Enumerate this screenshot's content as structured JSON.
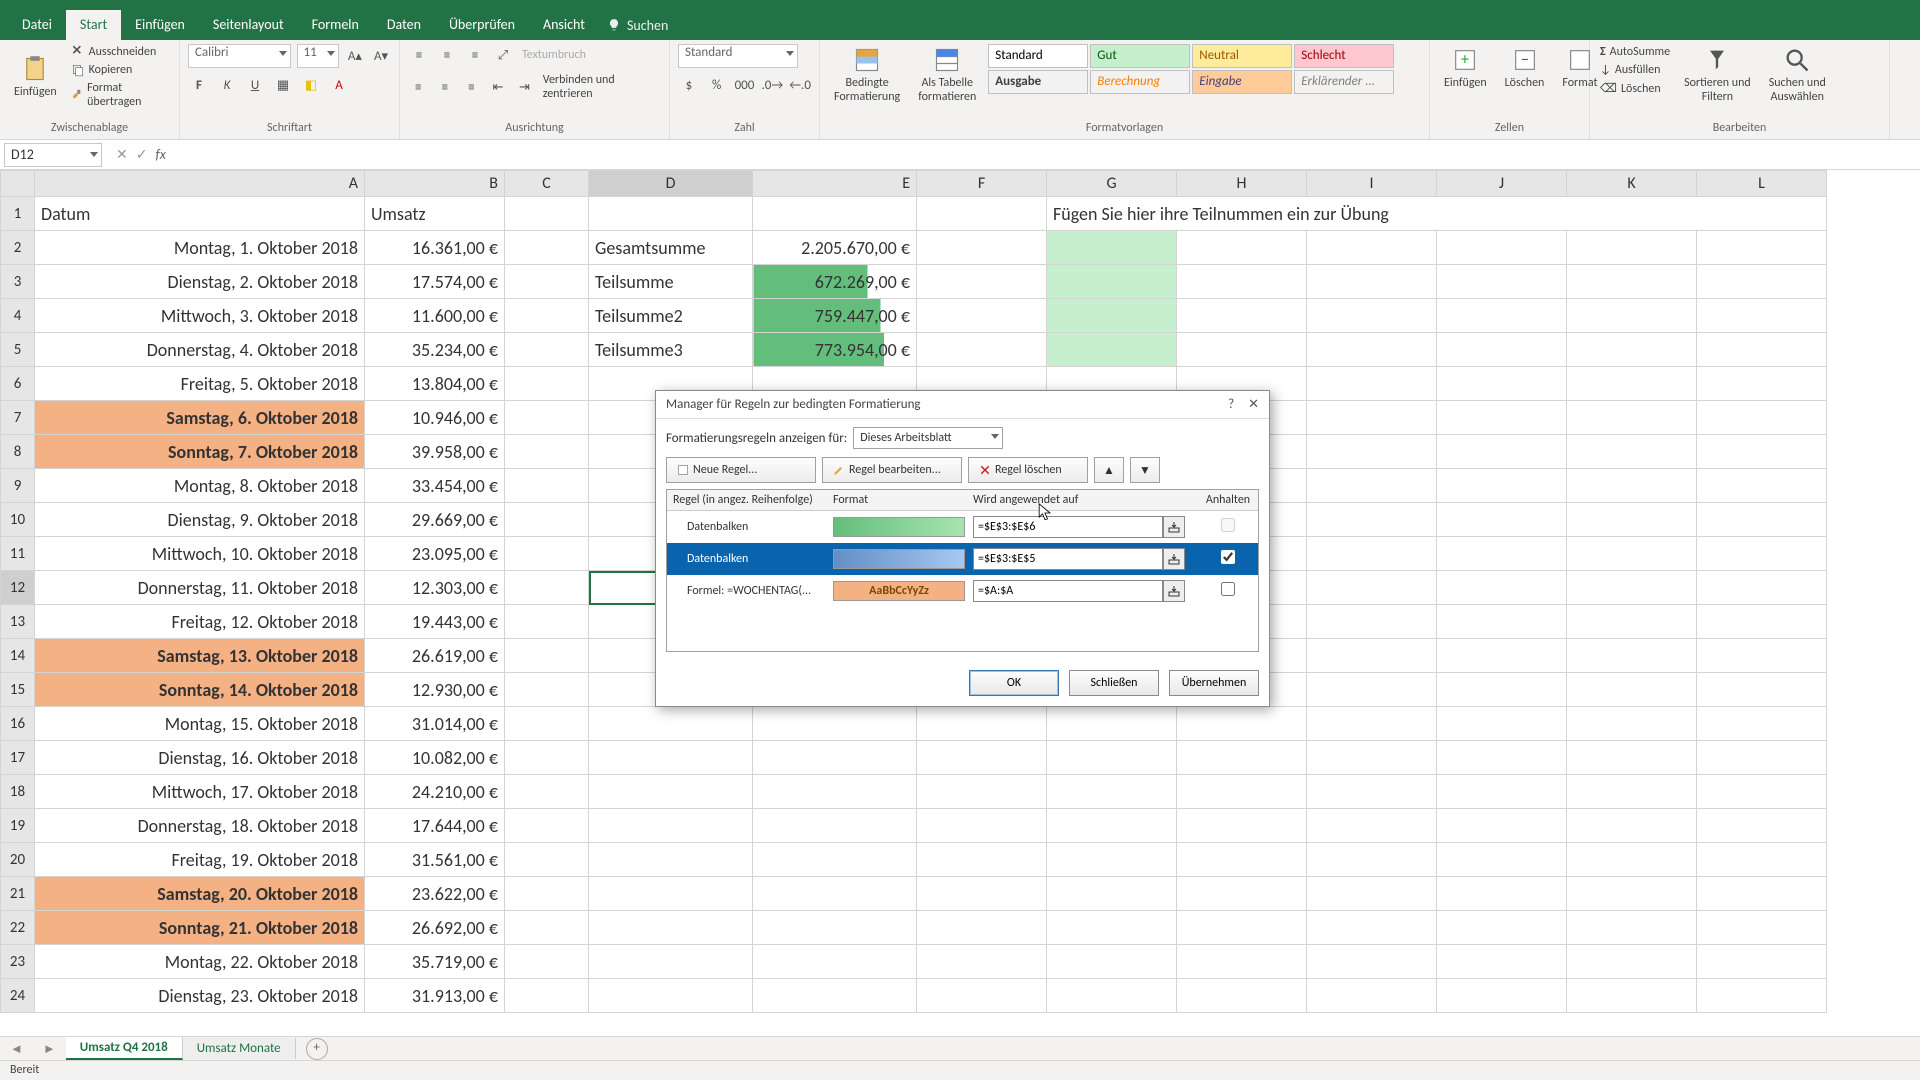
{
  "ribbon_tabs": [
    "Datei",
    "Start",
    "Einfügen",
    "Seitenlayout",
    "Formeln",
    "Daten",
    "Überprüfen",
    "Ansicht"
  ],
  "ribbon_active": "Start",
  "search_placeholder": "Suchen",
  "clipboard": {
    "paste": "Einfügen",
    "cut": "Ausschneiden",
    "copy": "Kopieren",
    "painter": "Format übertragen",
    "label": "Zwischenablage"
  },
  "font": {
    "name": "Calibri",
    "size": "11",
    "label": "Schriftart"
  },
  "alignment": {
    "wrap": "Textumbruch",
    "merge": "Verbinden und zentrieren",
    "label": "Ausrichtung"
  },
  "number": {
    "format": "Standard",
    "label": "Zahl"
  },
  "styles": {
    "cond": "Bedingte\nFormatierung",
    "table": "Als Tabelle\nformatieren",
    "cells": [
      "Standard",
      "Gut",
      "Neutral",
      "Schlecht",
      "Ausgabe",
      "Berechnung",
      "Eingabe",
      "Erklärender ..."
    ],
    "label": "Formatvorlagen"
  },
  "cells": {
    "insert": "Einfügen",
    "delete": "Löschen",
    "format": "Format",
    "label": "Zellen"
  },
  "editing": {
    "autosum": "AutoSumme",
    "fill": "Ausfüllen",
    "clear": "Löschen",
    "sort": "Sortieren und\nFiltern",
    "find": "Suchen und\nAuswählen",
    "label": "Bearbeiten"
  },
  "name_box": "D12",
  "columns": [
    "A",
    "B",
    "C",
    "D",
    "E",
    "F",
    "G",
    "H",
    "I",
    "J",
    "K",
    "L"
  ],
  "header_row": {
    "A": "Datum",
    "B": "Umsatz",
    "G": "Fügen Sie hier ihre Teilnummen ein zur Übung"
  },
  "summary": [
    {
      "label": "Gesamtsumme",
      "value": "2.205.670,00 €"
    },
    {
      "label": "Teilsumme",
      "value": "672.269,00 €"
    },
    {
      "label": "Teilsumme2",
      "value": "759.447,00 €"
    },
    {
      "label": "Teilsumme3",
      "value": "773.954,00 €"
    }
  ],
  "rows": [
    {
      "n": 2,
      "date": "Montag, 1. Oktober 2018",
      "rev": "16.361,00 €",
      "wk": false
    },
    {
      "n": 3,
      "date": "Dienstag, 2. Oktober 2018",
      "rev": "17.574,00 €",
      "wk": false
    },
    {
      "n": 4,
      "date": "Mittwoch, 3. Oktober 2018",
      "rev": "11.600,00 €",
      "wk": false
    },
    {
      "n": 5,
      "date": "Donnerstag, 4. Oktober 2018",
      "rev": "35.234,00 €",
      "wk": false
    },
    {
      "n": 6,
      "date": "Freitag, 5. Oktober 2018",
      "rev": "13.804,00 €",
      "wk": false
    },
    {
      "n": 7,
      "date": "Samstag, 6. Oktober 2018",
      "rev": "10.946,00 €",
      "wk": true
    },
    {
      "n": 8,
      "date": "Sonntag, 7. Oktober 2018",
      "rev": "39.958,00 €",
      "wk": true
    },
    {
      "n": 9,
      "date": "Montag, 8. Oktober 2018",
      "rev": "33.454,00 €",
      "wk": false
    },
    {
      "n": 10,
      "date": "Dienstag, 9. Oktober 2018",
      "rev": "29.669,00 €",
      "wk": false
    },
    {
      "n": 11,
      "date": "Mittwoch, 10. Oktober 2018",
      "rev": "23.095,00 €",
      "wk": false
    },
    {
      "n": 12,
      "date": "Donnerstag, 11. Oktober 2018",
      "rev": "12.303,00 €",
      "wk": false
    },
    {
      "n": 13,
      "date": "Freitag, 12. Oktober 2018",
      "rev": "19.443,00 €",
      "wk": false
    },
    {
      "n": 14,
      "date": "Samstag, 13. Oktober 2018",
      "rev": "26.619,00 €",
      "wk": true
    },
    {
      "n": 15,
      "date": "Sonntag, 14. Oktober 2018",
      "rev": "12.930,00 €",
      "wk": true
    },
    {
      "n": 16,
      "date": "Montag, 15. Oktober 2018",
      "rev": "31.014,00 €",
      "wk": false
    },
    {
      "n": 17,
      "date": "Dienstag, 16. Oktober 2018",
      "rev": "10.082,00 €",
      "wk": false
    },
    {
      "n": 18,
      "date": "Mittwoch, 17. Oktober 2018",
      "rev": "24.210,00 €",
      "wk": false
    },
    {
      "n": 19,
      "date": "Donnerstag, 18. Oktober 2018",
      "rev": "17.644,00 €",
      "wk": false
    },
    {
      "n": 20,
      "date": "Freitag, 19. Oktober 2018",
      "rev": "31.561,00 €",
      "wk": false
    },
    {
      "n": 21,
      "date": "Samstag, 20. Oktober 2018",
      "rev": "23.622,00 €",
      "wk": true
    },
    {
      "n": 22,
      "date": "Sonntag, 21. Oktober 2018",
      "rev": "26.692,00 €",
      "wk": true
    },
    {
      "n": 23,
      "date": "Montag, 22. Oktober 2018",
      "rev": "35.719,00 €",
      "wk": false
    },
    {
      "n": 24,
      "date": "Dienstag, 23. Oktober 2018",
      "rev": "31.913,00 €",
      "wk": false
    }
  ],
  "sheets": {
    "active": "Umsatz Q4 2018",
    "other": "Umsatz Monate"
  },
  "status": "Bereit",
  "dialog": {
    "title": "Manager für Regeln zur bedingten Formatierung",
    "scope_label": "Formatierungsregeln anzeigen für:",
    "scope_value": "Dieses Arbeitsblatt",
    "btn_new": "Neue Regel...",
    "btn_edit": "Regel bearbeiten...",
    "btn_del": "Regel löschen",
    "hdr_rule": "Regel (in angez. Reihenfolge)",
    "hdr_format": "Format",
    "hdr_applies": "Wird angewendet auf",
    "hdr_stop": "Anhalten",
    "rules": [
      {
        "name": "Datenbalken",
        "range": "=$E$3:$E$6",
        "type": "green",
        "stop": false,
        "sel": false
      },
      {
        "name": "Datenbalken",
        "range": "=$E$3:$E$5",
        "type": "blue",
        "stop": true,
        "sel": true
      },
      {
        "name": "Formel: =WOCHENTAG(...",
        "range": "=$A:$A",
        "type": "wknd",
        "preview": "AaBbCcYyZz",
        "stop": false,
        "sel": false
      }
    ],
    "ok": "OK",
    "close": "Schließen",
    "apply": "Übernehmen"
  }
}
